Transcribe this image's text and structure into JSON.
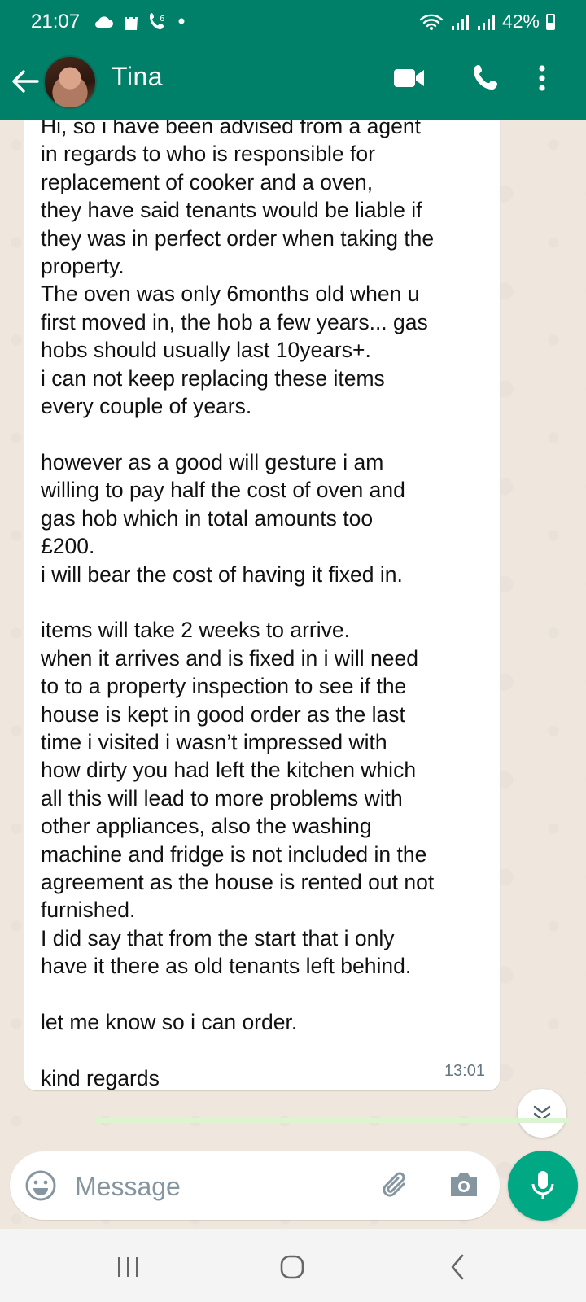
{
  "status_bar": {
    "time": "21:07",
    "battery": "42%",
    "left_icons": [
      "cloud-icon",
      "shopping-bag-icon",
      "voicemail-call-icon",
      "dot-icon"
    ],
    "right_icons": [
      "wifi-icon",
      "signal-icon",
      "signal-icon",
      "battery-icon"
    ]
  },
  "header": {
    "contact_name": "Tina",
    "actions": [
      "video-call-icon",
      "voice-call-icon",
      "more-vert-icon"
    ]
  },
  "message": {
    "text": "Hi, so i have been advised from a agent\nin regards to who is responsible for\nreplacement of cooker and a oven,\nthey have said tenants would be liable if\nthey was in perfect order when taking the\nproperty.\nThe oven was only 6months old when u\nfirst moved in, the hob a few years... gas\nhobs should usually last 10years+.\ni can not keep replacing these items\nevery couple of years.\n\nhowever as a good will gesture i am\nwilling to pay half the cost of oven and\ngas hob which in total amounts too\n£200.\ni will bear the cost of having it fixed in.\n\nitems will take 2 weeks to arrive.\nwhen it arrives and is fixed in i will need\nto to a property inspection to see if the\nhouse is kept in good order as the last\ntime i visited i wasn’t impressed with\nhow dirty you had left the kitchen which\nall this will lead to more problems with\nother appliances, also the washing\nmachine and fridge is not included in the\nagreement as the house is rented out not\nfurnished.\nI did say that from the start that i only\nhave it there as old tenants left behind.\n\nlet me know so i can order.\n\nkind regards",
    "time": "13:01"
  },
  "composer": {
    "placeholder": "Message"
  },
  "colors": {
    "header": "#008069",
    "accent": "#00a884",
    "chat_background": "#efe7de"
  }
}
